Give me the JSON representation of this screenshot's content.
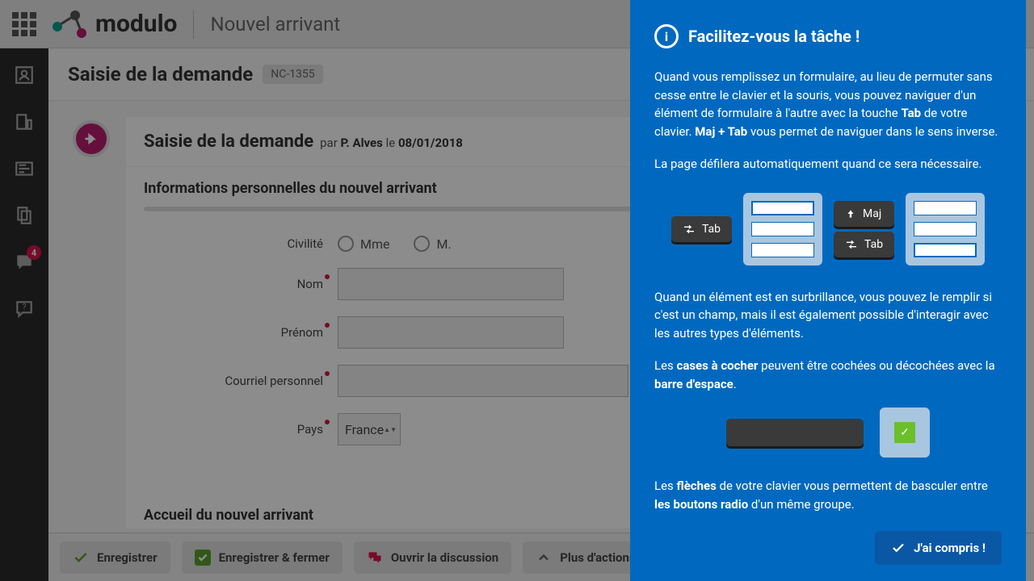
{
  "header": {
    "logo_text": "modulo",
    "subtitle": "Nouvel arrivant"
  },
  "sidebar": {
    "comment_badge": "4"
  },
  "page": {
    "title": "Saisie de la demande",
    "code": "NC-1355"
  },
  "form": {
    "title": "Saisie de la demande",
    "meta_par": "par",
    "meta_author": "P. Alves",
    "meta_le": "le",
    "meta_date": "08/01/2018",
    "section1_title": "Informations personnelles du nouvel arrivant",
    "section2_title": "Accueil du nouvel arrivant",
    "fields": {
      "civilite_label": "Civilité",
      "civilite_opt1": "Mme",
      "civilite_opt2": "M.",
      "nom_label": "Nom",
      "prenom_label": "Prénom",
      "courriel_label": "Courriel personnel",
      "pays_label": "Pays",
      "pays_value": "France"
    }
  },
  "actions": {
    "save": "Enregistrer",
    "save_close": "Enregistrer & fermer",
    "open_discussion": "Ouvrir la discussion",
    "more_actions": "Plus d'actions"
  },
  "help": {
    "title": "Facilitez-vous la tâche !",
    "p1_a": "Quand vous remplissez un formulaire, au lieu de permuter sans cesse entre le clavier et la souris, vous pouvez naviguer d'un élément de formulaire à l'autre avec la touche ",
    "p1_tab": "Tab",
    "p1_b": " de votre clavier. ",
    "p1_maj": "Maj + Tab",
    "p1_c": " vous permet de naviguer dans le sens inverse.",
    "p2": "La page défilera automatiquement quand ce sera nécessaire.",
    "key_tab": "Tab",
    "key_maj": "Maj",
    "p3": "Quand un élément est en surbrillance, vous pouvez le remplir si c'est un champ, mais il est également possible d'interagir avec les autres types d'éléments.",
    "p4_a": "Les ",
    "p4_b": "cases à cocher",
    "p4_c": " peuvent être cochées ou décochées avec la ",
    "p4_d": "barre d'espace",
    "p4_e": ".",
    "p5_a": "Les ",
    "p5_b": "flèches",
    "p5_c": " de votre clavier vous permettent de basculer entre ",
    "p5_d": "les boutons radio",
    "p5_e": " d'un même groupe.",
    "understood": "J'ai compris !"
  }
}
